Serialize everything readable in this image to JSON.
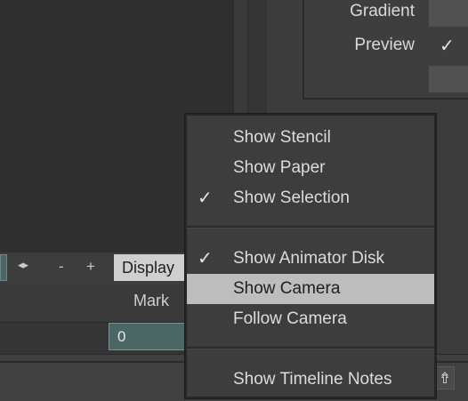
{
  "properties": {
    "gradient_label": "Gradient",
    "preview_label": "Preview",
    "preview_checked": "✓"
  },
  "toolbar": {
    "arrows_icon": "◂▸",
    "minus_label": "-",
    "plus_label": "+",
    "display_label": "Display",
    "mark_label": "Mark",
    "value": "0"
  },
  "context_menu": {
    "items": [
      {
        "label": "Show Stencil",
        "checked": ""
      },
      {
        "label": "Show Paper",
        "checked": ""
      },
      {
        "label": "Show Selection",
        "checked": "✓"
      },
      {
        "label": "Show Animator Disk",
        "checked": "✓"
      },
      {
        "label": "Show Camera",
        "checked": "",
        "highlighted": true
      },
      {
        "label": "Follow Camera",
        "checked": ""
      },
      {
        "label": "Show Timeline Notes",
        "checked": ""
      }
    ]
  },
  "corner_icon_glyph": "⇮",
  "colors": {
    "menu_bg": "#3d3d3d",
    "highlight_bg": "#bdbdbd",
    "field_teal": "#4a6765"
  }
}
